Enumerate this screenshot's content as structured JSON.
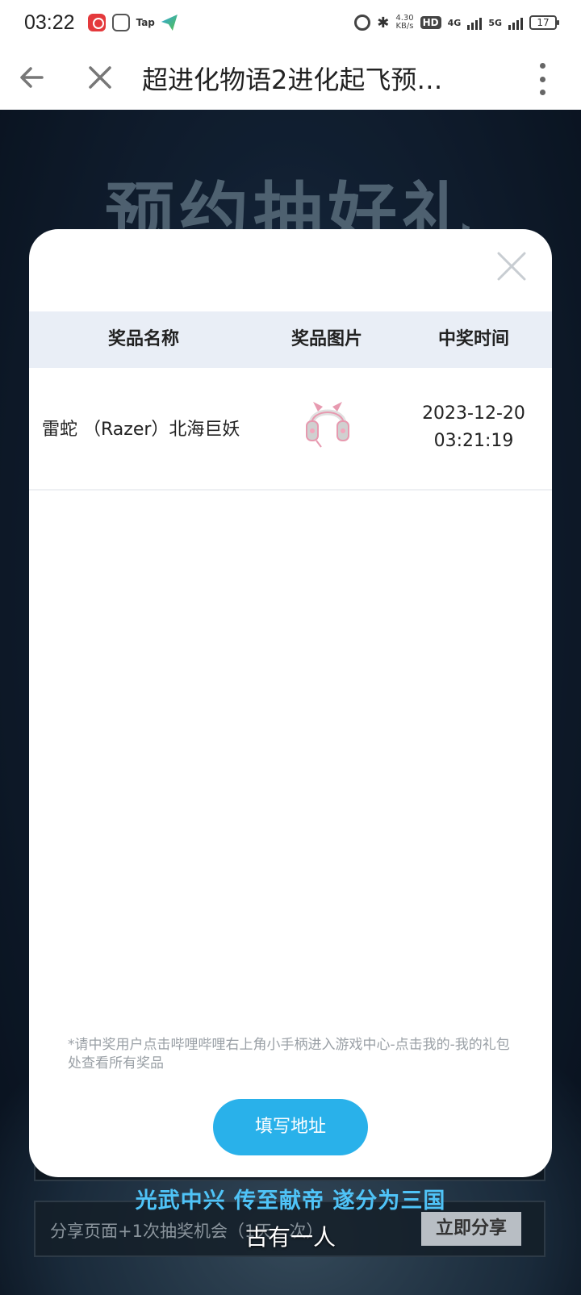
{
  "status_bar": {
    "time": "03:22",
    "tap_label": "Tap",
    "speed_value": "4.30",
    "speed_unit": "KB/s",
    "hd_label": "HD",
    "net_4g": "4G",
    "net_5g": "5G",
    "battery": "17"
  },
  "nav": {
    "title": "超进化物语2进化起飞预…"
  },
  "background": {
    "banner_text": "预约抽好礼",
    "slogan": "光武中兴 传至献帝 遂分为三国",
    "share_text": "分享页面+1次抽奖机会（1天一次）",
    "share_button": "立即分享",
    "subtitle": "古有一人"
  },
  "modal": {
    "table_headers": {
      "name": "奖品名称",
      "image": "奖品图片",
      "time": "中奖时间"
    },
    "rows": [
      {
        "name": "雷蛇 （Razer）北海巨妖",
        "image": "pink-cat-ear-headset",
        "date": "2023-12-20",
        "time": "03:21:19"
      }
    ],
    "notice": "*请中奖用户点击哔哩哔哩右上角小手柄进入游戏中心-点击我的-我的礼包处查看所有奖品",
    "address_button": "填写地址"
  },
  "colors": {
    "accent_button": "#29b1ea",
    "header_bg": "#e9eef6",
    "slogan": "#4fc3f7"
  }
}
